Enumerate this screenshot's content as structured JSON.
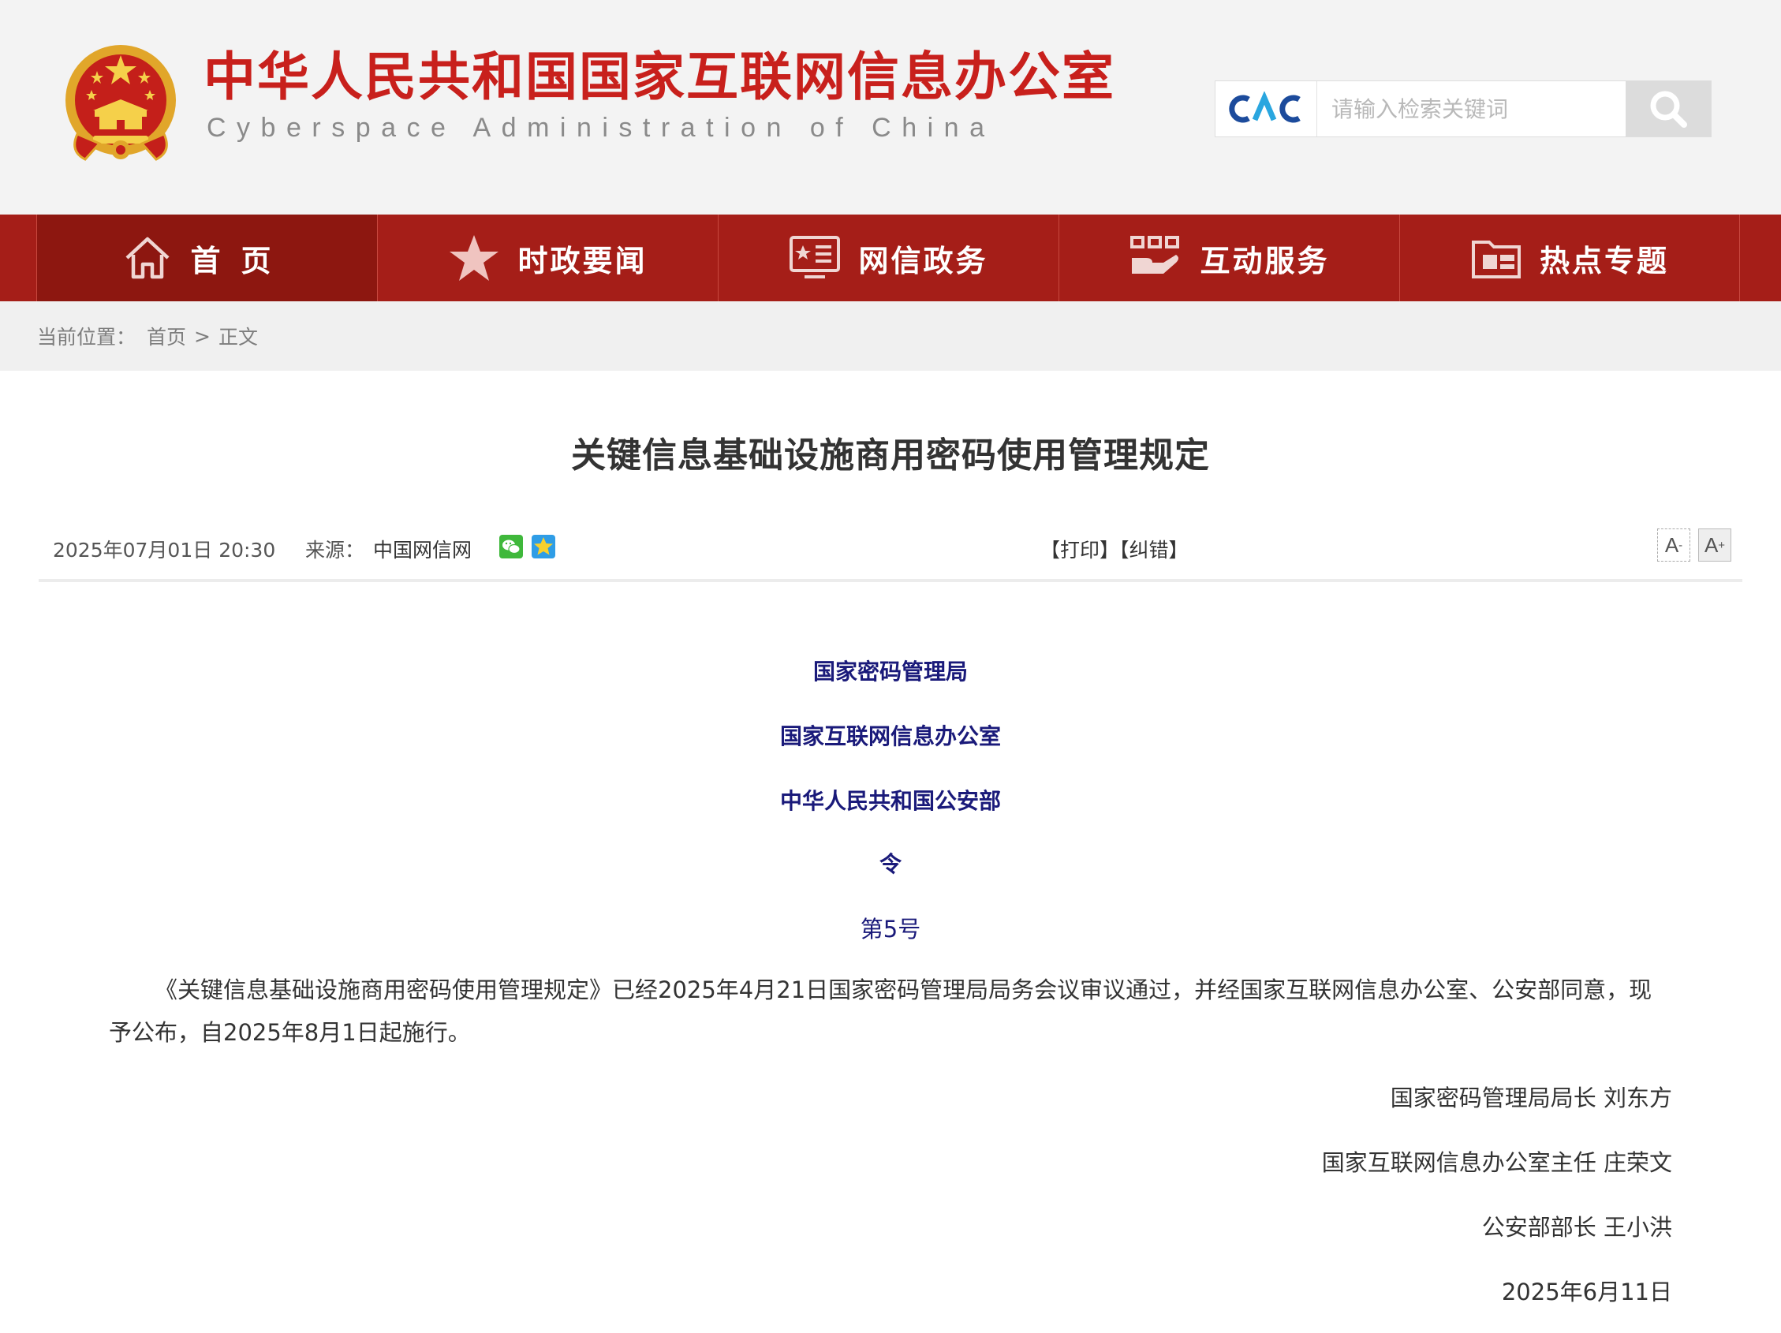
{
  "header": {
    "site_name_cn": "中华人民共和国国家互联网信息办公室",
    "site_name_en": "Cyberspace Administration of China",
    "search": {
      "logo_text": "CAC",
      "placeholder": "请输入检索关键词",
      "icon": "search-icon"
    }
  },
  "nav": {
    "items": [
      {
        "label": "首页",
        "icon": "home-icon",
        "active": true
      },
      {
        "label": "时政要闻",
        "icon": "star-icon",
        "active": false
      },
      {
        "label": "网信政务",
        "icon": "screen-doc-icon",
        "active": false
      },
      {
        "label": "互动服务",
        "icon": "hand-service-icon",
        "active": false
      },
      {
        "label": "热点专题",
        "icon": "folder-icon",
        "active": false
      }
    ],
    "colors": {
      "bar": "#a51e18",
      "active": "#8d1710"
    }
  },
  "breadcrumb": {
    "label": "当前位置：",
    "home": "首页",
    "separator": ">",
    "current": "正文"
  },
  "article": {
    "title": "关键信息基础设施商用密码使用管理规定",
    "meta": {
      "datetime": "2025年07月01日 20:30",
      "source_label": "来源：",
      "source": "中国网信网",
      "share_icons": [
        "wechat-icon",
        "qzone-icon"
      ],
      "print": "【打印】",
      "correct": "【纠错】",
      "font_decrease": "A",
      "font_increase": "A",
      "font_increase_sup": "+"
    },
    "orgs": [
      "国家密码管理局",
      "国家互联网信息办公室",
      "中华人民共和国公安部"
    ],
    "order": "令",
    "order_no": "第5号",
    "paragraph": "《关键信息基础设施商用密码使用管理规定》已经2025年4月21日国家密码管理局局务会议审议通过，并经国家互联网信息办公室、公安部同意，现予公布，自2025年8月1日起施行。",
    "signatures": [
      "国家密码管理局局长 刘东方",
      "国家互联网信息办公室主任 庄荣文",
      "公安部部长 王小洪"
    ],
    "date": "2025年6月11日",
    "colors": {
      "org_text": "#1a1a7a",
      "brand_red": "#c8201c"
    }
  }
}
